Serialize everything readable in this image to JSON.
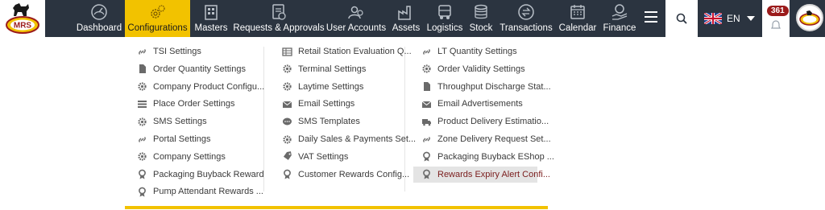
{
  "app": {
    "logo_text": "MRS"
  },
  "nav": {
    "items": [
      {
        "label": "Dashboard",
        "icon": "speedometer-icon"
      },
      {
        "label": "Configurations",
        "icon": "gears-icon",
        "active": true
      },
      {
        "label": "Masters",
        "icon": "building-icon"
      },
      {
        "label": "Requests & Approvals",
        "icon": "document-check-icon"
      },
      {
        "label": "User Accounts",
        "icon": "user-group-icon"
      },
      {
        "label": "Assets",
        "icon": "factory-icon"
      },
      {
        "label": "Logistics",
        "icon": "truck-icon"
      },
      {
        "label": "Stock",
        "icon": "coins-stack-icon"
      },
      {
        "label": "Transactions",
        "icon": "exchange-icon"
      },
      {
        "label": "Calendar",
        "icon": "calendar-icon"
      },
      {
        "label": "Finance",
        "icon": "money-hand-icon"
      }
    ],
    "menu_icon": "hamburger-icon",
    "search_icon": "search-icon"
  },
  "language": {
    "code": "EN",
    "flag": "uk-flag-icon"
  },
  "notifications": {
    "count": "361"
  },
  "colors": {
    "topbar": "#2b3440",
    "accent": "#f2c200",
    "selected_text": "#7a1c1c"
  },
  "dropdown": {
    "columns": [
      [
        {
          "label": "TSI Settings",
          "icon": "link-icon"
        },
        {
          "label": "Order Quantity Settings",
          "icon": "file-icon"
        },
        {
          "label": "Company Product Configu...",
          "icon": "gear-icon"
        },
        {
          "label": "Place Order Settings",
          "icon": "list-icon"
        },
        {
          "label": "SMS Settings",
          "icon": "gear-icon"
        },
        {
          "label": "Portal Settings",
          "icon": "link-icon"
        },
        {
          "label": "Company Settings",
          "icon": "gear-icon"
        },
        {
          "label": "Packaging Buyback Reward",
          "icon": "award-icon"
        },
        {
          "label": "Pump Attendant Rewards ...",
          "icon": "award-icon"
        }
      ],
      [
        {
          "label": "Retail Station Evaluation Q...",
          "icon": "table-icon"
        },
        {
          "label": "Terminal Settings",
          "icon": "gear-icon"
        },
        {
          "label": "Laytime Settings",
          "icon": "gear-icon"
        },
        {
          "label": "Email Settings",
          "icon": "envelope-icon"
        },
        {
          "label": "SMS Templates",
          "icon": "chat-icon"
        },
        {
          "label": "Daily Sales & Payments Set...",
          "icon": "gear-icon"
        },
        {
          "label": "VAT Settings",
          "icon": "tag-icon"
        },
        {
          "label": "Customer Rewards Config...",
          "icon": "award-icon"
        }
      ],
      [
        {
          "label": "LT Quantity Settings",
          "icon": "link-icon"
        },
        {
          "label": "Order Validity Settings",
          "icon": "gear-icon"
        },
        {
          "label": "Throughput Discharge Stat...",
          "icon": "file-icon"
        },
        {
          "label": "Email Advertisements",
          "icon": "envelope-icon"
        },
        {
          "label": "Product Delivery Estimatio...",
          "icon": "truck-icon"
        },
        {
          "label": "Zone Delivery Request Set...",
          "icon": "link-icon"
        },
        {
          "label": "Packaging Buyback EShop ...",
          "icon": "award-icon"
        },
        {
          "label": "Rewards Expiry Alert Confi...",
          "icon": "award-icon",
          "selected": true
        }
      ]
    ]
  }
}
